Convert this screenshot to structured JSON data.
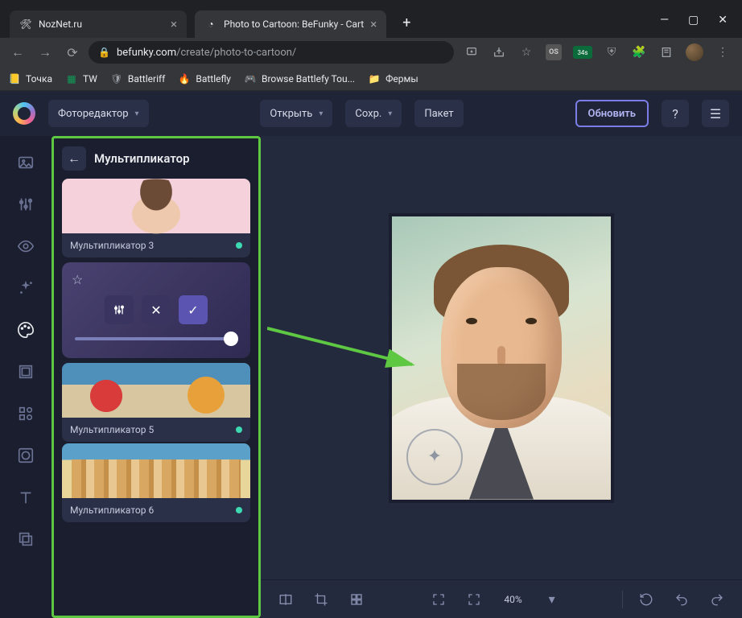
{
  "browser": {
    "tabs": [
      {
        "title": "NozNet.ru",
        "favicon": "🛠"
      },
      {
        "title": "Photo to Cartoon: BeFunky - Cart",
        "favicon": "◔"
      }
    ],
    "url_prefix": "befunky.com",
    "url_path": "/create/photo-to-cartoon/",
    "bookmarks": [
      {
        "icon": "📒",
        "label": "Точка",
        "color": "#f4b400"
      },
      {
        "icon": "▦",
        "label": "TW",
        "color": "#0f9d58"
      },
      {
        "icon": "🛡",
        "label": "Battleriff",
        "color": "#9aa0a6"
      },
      {
        "icon": "🔥",
        "label": "Battlefly",
        "color": "#e25822"
      },
      {
        "icon": "🎮",
        "label": "Browse Battlefy Tou...",
        "color": "#7e57c2"
      },
      {
        "icon": "📁",
        "label": "Фермы",
        "color": "#f4b400"
      }
    ],
    "ext_badge": "34s"
  },
  "app": {
    "menu": {
      "editor": "Фоторедактор",
      "open": "Открыть",
      "save": "Сохр.",
      "batch": "Пакет"
    },
    "upgrade": "Обновить",
    "panel": {
      "title": "Мультипликатор",
      "items": [
        {
          "label": "Мультипликатор 3"
        },
        {
          "label": "Мультипликатор 5"
        },
        {
          "label": "Мультипликатор 6"
        }
      ]
    },
    "zoom": "40%"
  }
}
